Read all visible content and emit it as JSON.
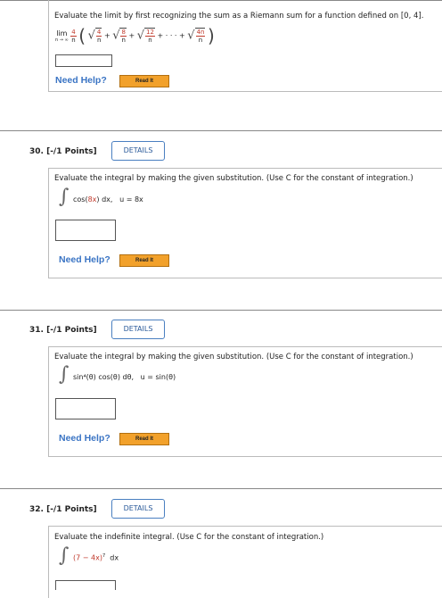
{
  "problems": [
    {
      "prompt": "Evaluate the limit by first recognizing the sum as a Riemann sum for a function defined on [0, 4].",
      "limit_label": "lim",
      "limit_sub": "n → ∞",
      "coef_num": "4",
      "coef_den": "n",
      "terms": [
        {
          "num": "4",
          "den": "n"
        },
        {
          "num": "8",
          "den": "n"
        },
        {
          "num": "12",
          "den": "n"
        },
        {
          "num": "4n",
          "den": "n"
        }
      ],
      "plus": "+",
      "ellipsis": "+ · · · +",
      "need_help": "Need Help?",
      "read_it": "Read It"
    },
    {
      "title": "30. [-/1 Points]",
      "details": "DETAILS",
      "prompt": "Evaluate the integral by making the given substitution. (Use C for the constant of integration.)",
      "integrand_a": "cos(",
      "integrand_red": "8x",
      "integrand_b": ") dx,",
      "substitution": "u = 8x",
      "need_help": "Need Help?",
      "read_it": "Read It"
    },
    {
      "title": "31. [-/1 Points]",
      "details": "DETAILS",
      "prompt": "Evaluate the integral by making the given substitution. (Use C for the constant of integration.)",
      "integrand": "sin⁴(θ) cos(θ) dθ,",
      "substitution": "u = sin(θ)",
      "need_help": "Need Help?",
      "read_it": "Read It"
    },
    {
      "title": "32. [-/1 Points]",
      "details": "DETAILS",
      "prompt": "Evaluate the indefinite integral. (Use C for the constant of integration.)",
      "integrand_red": "(7 − 4x)",
      "exponent": "7",
      "integrand_b": "dx"
    }
  ]
}
